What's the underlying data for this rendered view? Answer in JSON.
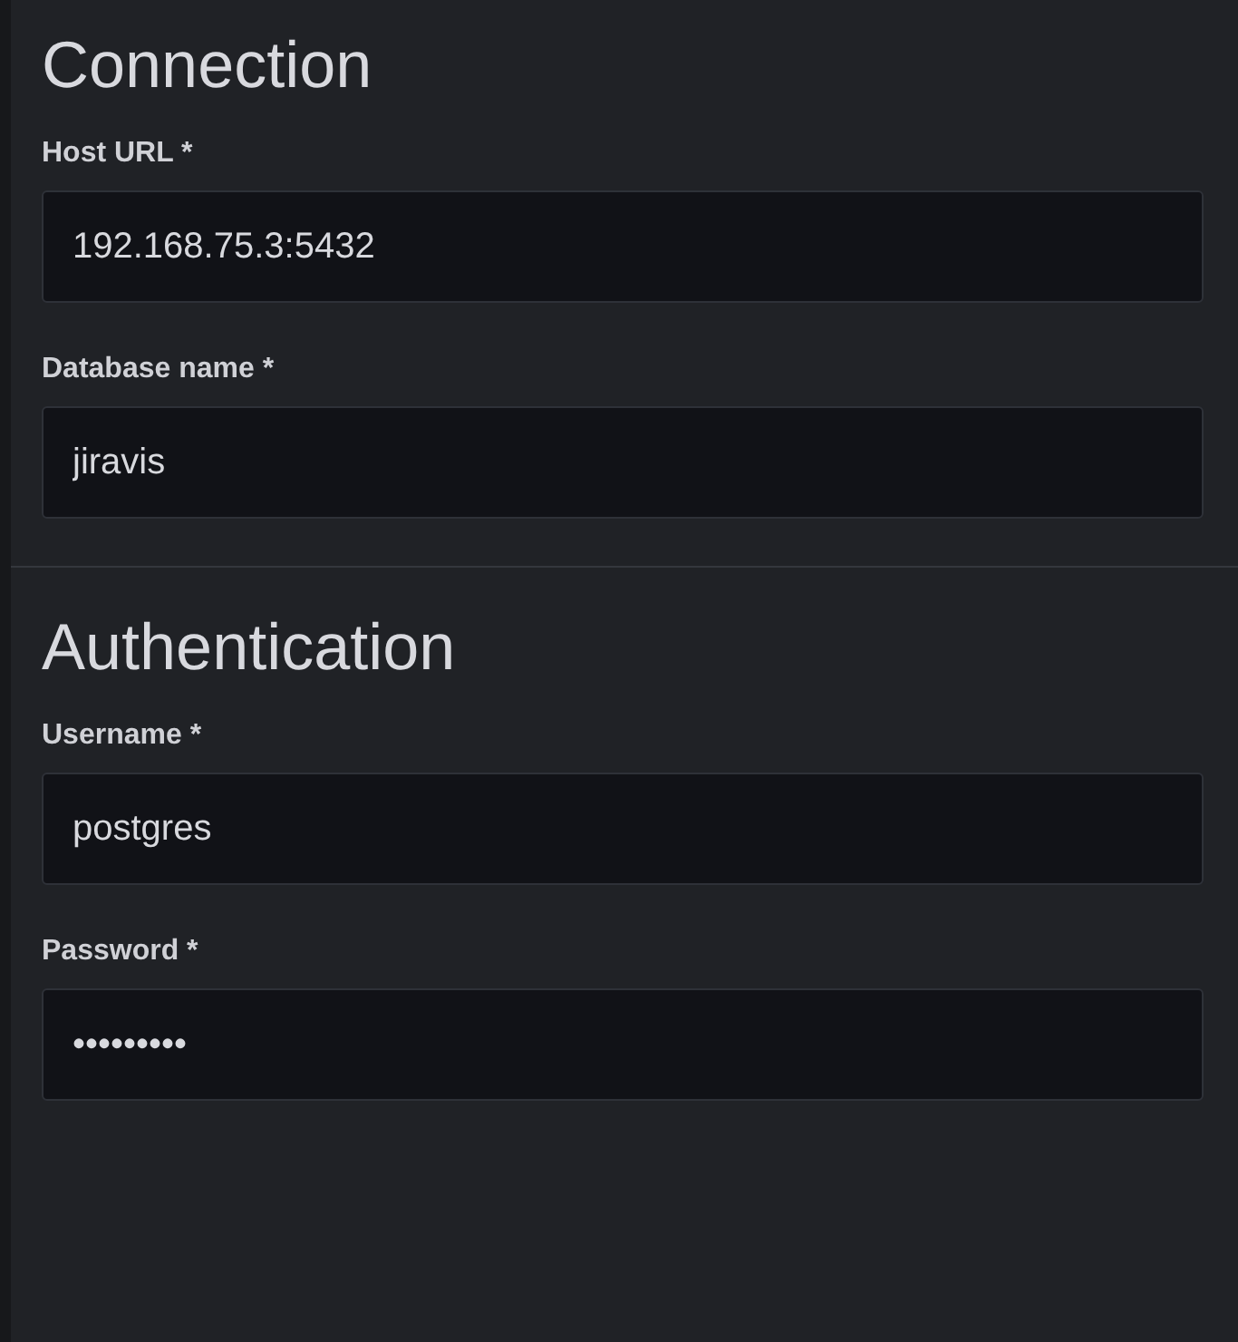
{
  "sections": [
    {
      "title": "Connection",
      "fields": [
        {
          "label": "Host URL *",
          "value": "192.168.75.3:5432"
        },
        {
          "label": "Database name *",
          "value": "jiravis"
        }
      ]
    },
    {
      "title": "Authentication",
      "fields": [
        {
          "label": "Username *",
          "value": "postgres"
        },
        {
          "label": "Password *",
          "value": "•••••••••"
        }
      ]
    }
  ]
}
